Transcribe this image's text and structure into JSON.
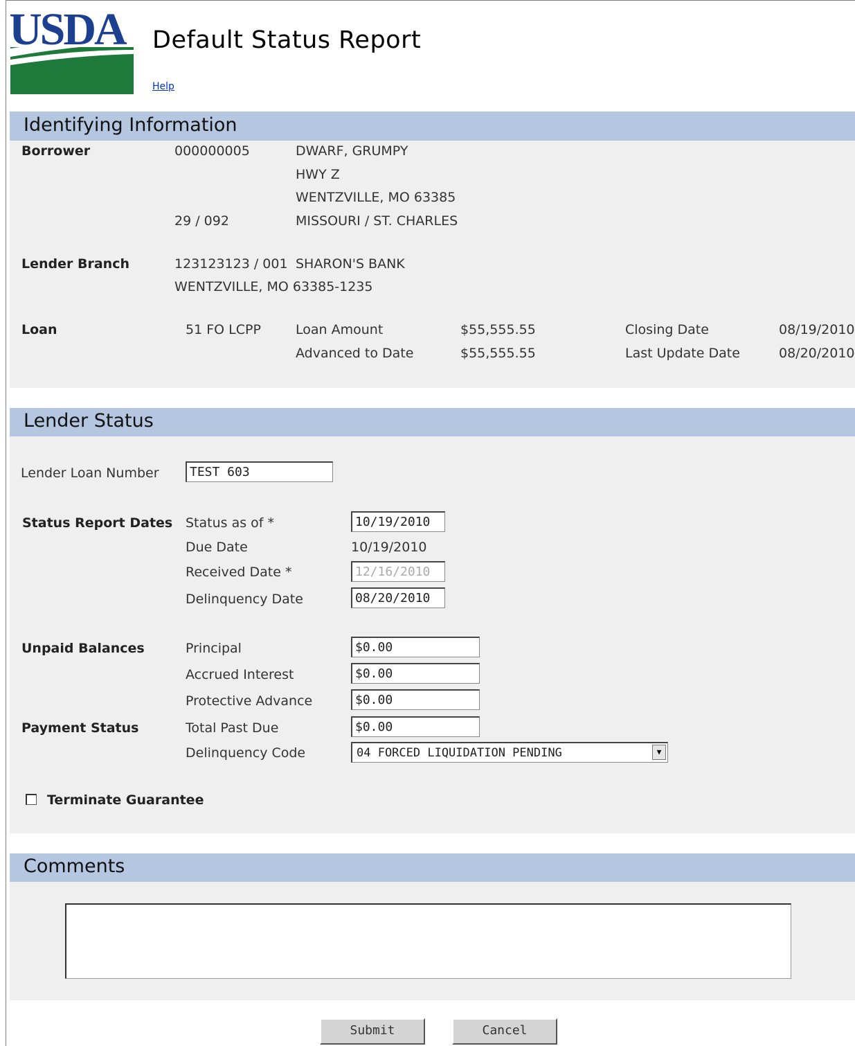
{
  "header": {
    "logo_text": "USDA",
    "title": "Default Status Report",
    "help_link": "Help"
  },
  "identifying": {
    "section_title": "Identifying Information",
    "borrower_label": "Borrower",
    "borrower_id": "000000005",
    "borrower_name": "DWARF, GRUMPY",
    "address_line1": "HWY Z",
    "address_line2": "WENTZVILLE, MO 63385",
    "state_county_code": "29 / 092",
    "state_county_name": "MISSOURI / ST. CHARLES",
    "lender_branch_label": "Lender Branch",
    "lender_id": "123123123 / 001",
    "lender_name": "SHARON'S BANK",
    "lender_address": "WENTZVILLE, MO 63385-1235",
    "loan_label": "Loan",
    "loan_type": "51 FO LCPP",
    "loan_amount_label": "Loan Amount",
    "loan_amount": "$55,555.55",
    "advanced_label": "Advanced to Date",
    "advanced_amount": "$55,555.55",
    "closing_date_label": "Closing Date",
    "closing_date": "08/19/2010",
    "last_update_label": "Last Update Date",
    "last_update_date": "08/20/2010"
  },
  "lender_status": {
    "section_title": "Lender Status",
    "lender_loan_number_label": "Lender Loan Number",
    "lender_loan_number": "TEST 603",
    "status_report_dates_label": "Status Report Dates",
    "status_as_of_label": "Status as of *",
    "status_as_of": "10/19/2010",
    "due_date_label": "Due Date",
    "due_date": "10/19/2010",
    "received_date_label": "Received Date *",
    "received_date": "12/16/2010",
    "delinquency_date_label": "Delinquency Date",
    "delinquency_date": "08/20/2010",
    "unpaid_balances_label": "Unpaid Balances",
    "principal_label": "Principal",
    "principal": "$0.00",
    "accrued_interest_label": "Accrued Interest",
    "accrued_interest": "$0.00",
    "protective_advance_label": "Protective Advance",
    "protective_advance": "$0.00",
    "payment_status_label": "Payment Status",
    "total_past_due_label": "Total Past Due",
    "total_past_due": "$0.00",
    "delinquency_code_label": "Delinquency Code",
    "delinquency_code": "04 FORCED LIQUIDATION PENDING",
    "terminate_label": "Terminate Guarantee",
    "terminate_checked": false
  },
  "comments": {
    "section_title": "Comments",
    "value": ""
  },
  "buttons": {
    "submit": "Submit",
    "cancel": "Cancel"
  },
  "colors": {
    "section_band": "#b4c6e0",
    "panel": "#efefef",
    "logo_blue": "#1d3f8f",
    "logo_green": "#1e7a3a",
    "help_link": "#0033cc"
  }
}
